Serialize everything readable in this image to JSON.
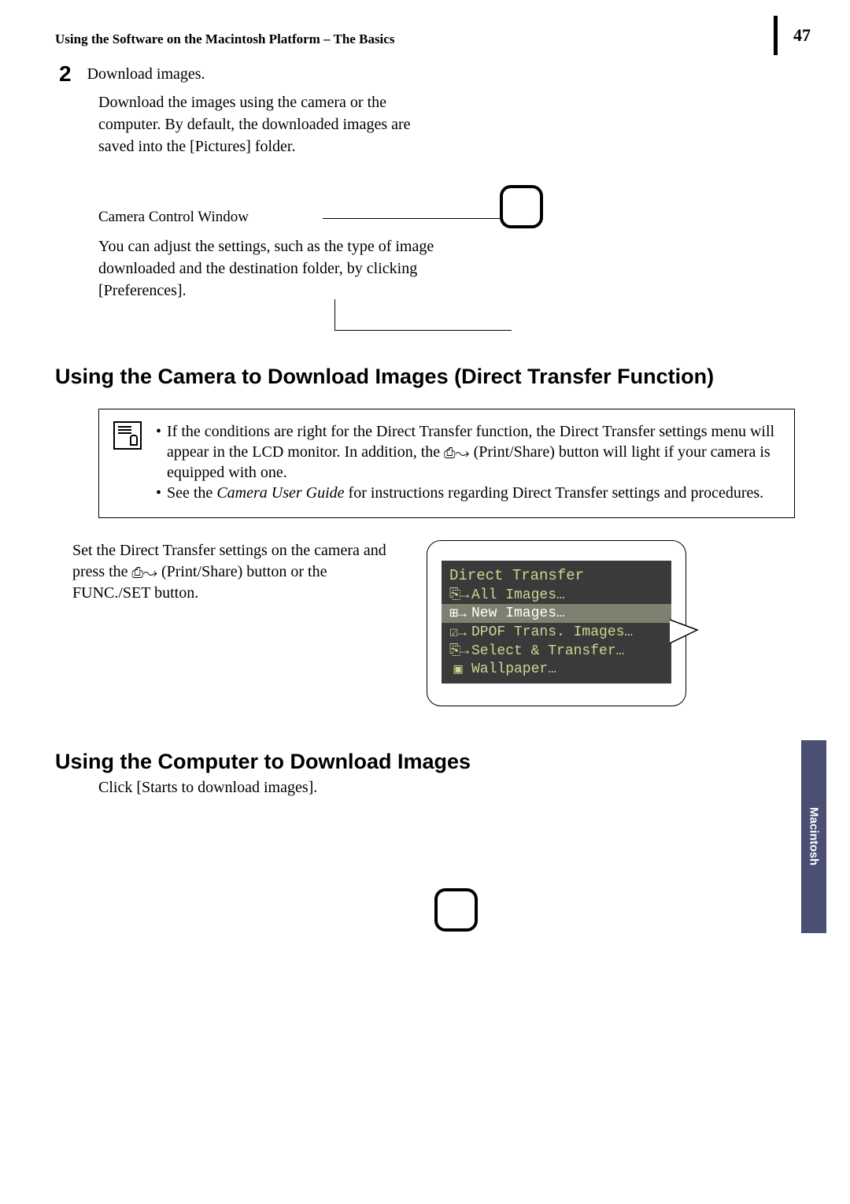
{
  "header": {
    "title": "Using the Software on the Macintosh Platform – The Basics",
    "page_number": "47"
  },
  "step": {
    "number": "2",
    "title": "Download images.",
    "body": "Download the images using the camera or the computer. By default, the downloaded images are saved into the [Pictures] folder."
  },
  "camera_control": {
    "label": "Camera Control Window",
    "text": "You can adjust the settings, such as the type of image downloaded and the destination folder, by clicking [Preferences]."
  },
  "section1": {
    "heading": "Using the Camera to Download Images (Direct Transfer Function)"
  },
  "note": {
    "bullet1_a": "If the conditions are right for the Direct Transfer function, the Direct Transfer settings menu will appear in the LCD monitor. In addition, the ",
    "bullet1_b": " (Print/Share) button will light if your camera is equipped with one.",
    "bullet2_a": "See the ",
    "bullet2_italic": "Camera User Guide",
    "bullet2_b": " for instructions regarding Direct Transfer settings and procedures."
  },
  "transfer": {
    "text_a": "Set the Direct Transfer settings on the camera and press the ",
    "text_b": " (Print/Share) button or the FUNC./SET button."
  },
  "lcd": {
    "title": "Direct Transfer",
    "items": [
      {
        "icon": "⎘→",
        "label": "All Images…",
        "selected": false
      },
      {
        "icon": "⊞→",
        "label": "New Images…",
        "selected": true
      },
      {
        "icon": "☑→",
        "label": "DPOF Trans. Images…",
        "selected": false
      },
      {
        "icon": "⎘→",
        "label": "Select & Transfer…",
        "selected": false
      },
      {
        "icon": "▣",
        "label": "Wallpaper…",
        "selected": false
      }
    ]
  },
  "section2": {
    "heading": "Using the Computer to Download Images",
    "text": "Click [Starts to download images]."
  },
  "side_tab": "Macintosh",
  "print_share_glyph": "⎙↝"
}
